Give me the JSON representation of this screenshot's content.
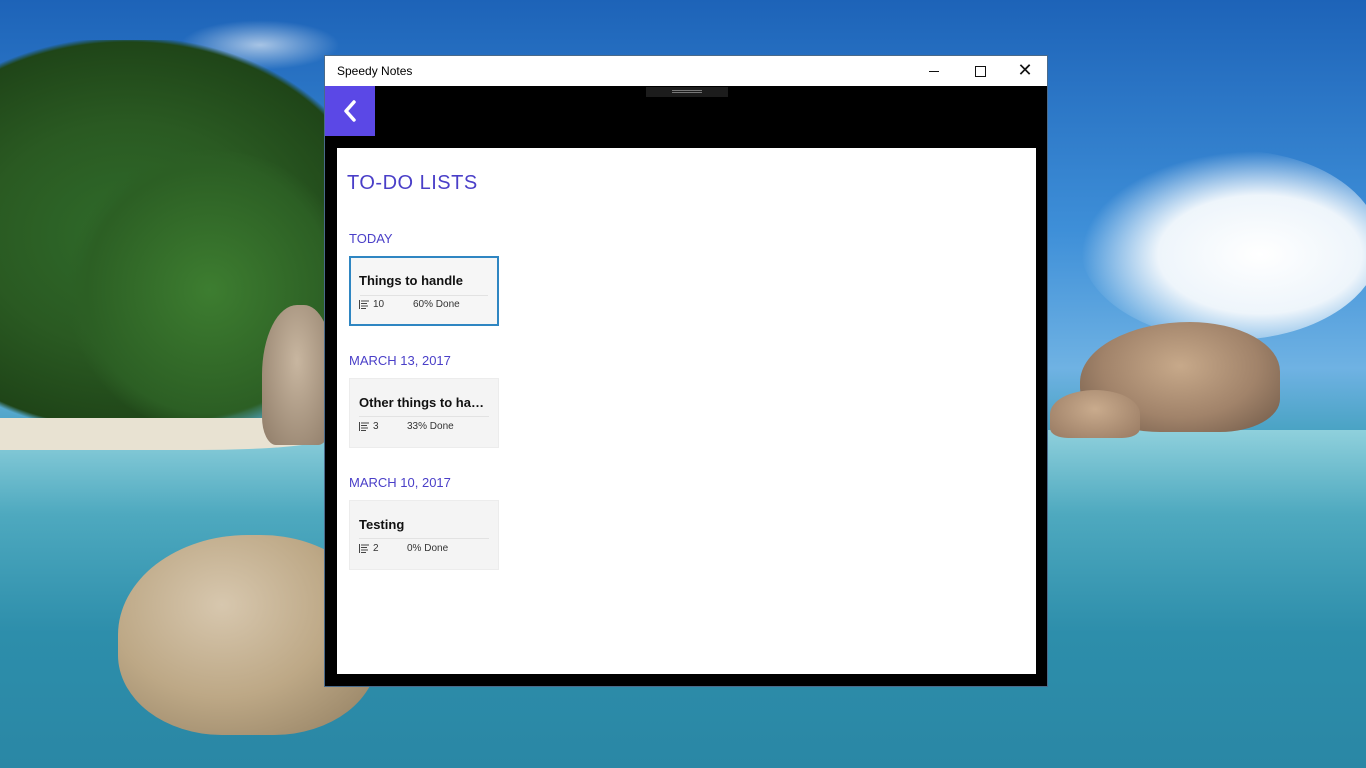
{
  "window": {
    "title": "Speedy Notes"
  },
  "page": {
    "title": "TO-DO LISTS"
  },
  "groups": [
    {
      "label": "TODAY",
      "lists": [
        {
          "title": "Things to handle",
          "count": "10",
          "progress": "60% Done",
          "selected": true
        }
      ]
    },
    {
      "label": "MARCH 13, 2017",
      "lists": [
        {
          "title": "Other things to han...",
          "count": "3",
          "progress": "33% Done",
          "selected": false
        }
      ]
    },
    {
      "label": "MARCH 10, 2017",
      "lists": [
        {
          "title": "Testing",
          "count": "2",
          "progress": "0% Done",
          "selected": false
        }
      ]
    }
  ],
  "colors": {
    "accent": "#5b48e6",
    "heading": "#4a3fc8",
    "selection_border": "#2f86c2"
  },
  "icons": [
    "back-arrow-icon",
    "list-items-icon",
    "minimize-icon",
    "maximize-icon",
    "close-icon"
  ]
}
